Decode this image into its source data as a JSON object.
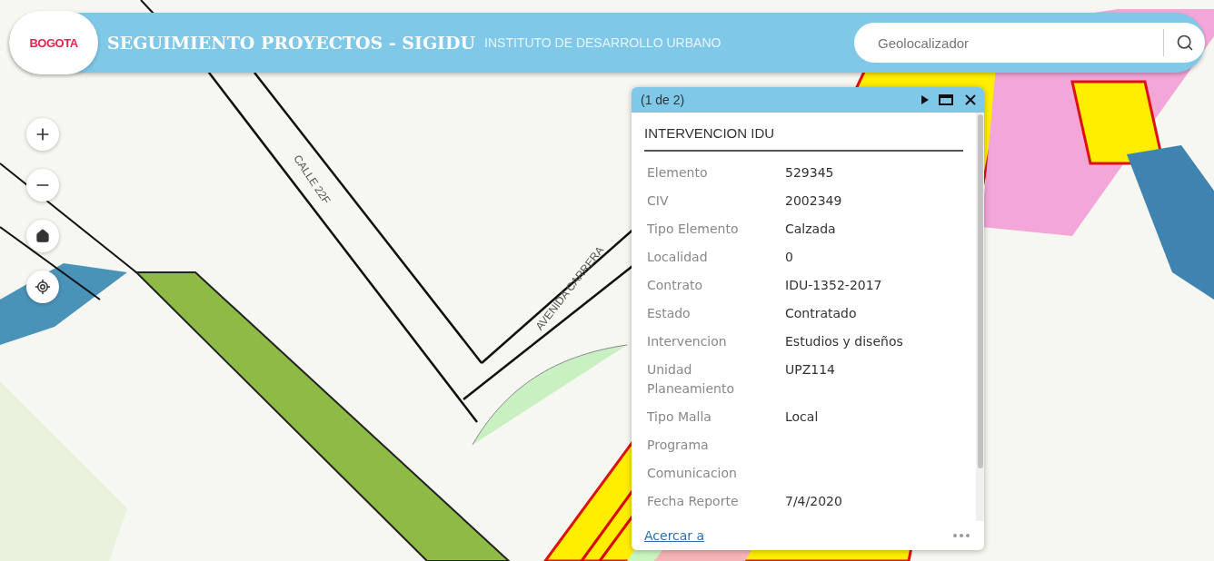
{
  "header": {
    "logo_text": "BOGOTA",
    "title": "SEGUIMIENTO PROYECTOS - SIGIDU",
    "subtitle": "INSTITUTO DE DESARROLLO URBANO"
  },
  "search": {
    "placeholder": "Geolocalizador"
  },
  "map": {
    "street_labels": [
      {
        "text": "CALLE 22F"
      },
      {
        "text": "AVENIDA CARRERA"
      }
    ]
  },
  "popup": {
    "pager": "(1 de 2)",
    "title": "INTERVENCION IDU",
    "fields": [
      {
        "label": "Elemento",
        "value": "529345"
      },
      {
        "label": "CIV",
        "value": "2002349"
      },
      {
        "label": "Tipo Elemento",
        "value": "Calzada"
      },
      {
        "label": "Localidad",
        "value": "0"
      },
      {
        "label": "Contrato",
        "value": "IDU-1352-2017"
      },
      {
        "label": "Estado",
        "value": "Contratado"
      },
      {
        "label": "Intervencion",
        "value": "Estudios y diseños"
      },
      {
        "label": "Unidad Planeamiento",
        "value": "UPZ114"
      },
      {
        "label": "Tipo Malla",
        "value": "Local"
      },
      {
        "label": "Programa"
      },
      {
        "label": "Comunicacion"
      },
      {
        "label": "Fecha Reporte",
        "value": "7/4/2020"
      }
    ],
    "zoom_link": "Acercar a"
  }
}
